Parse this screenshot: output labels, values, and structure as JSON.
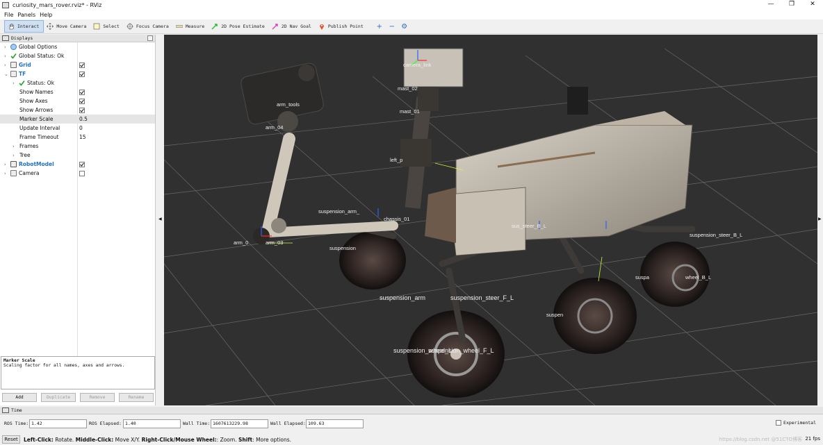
{
  "window": {
    "title": "curiosity_mars_rover.rviz* - RViz",
    "minimize": "—",
    "maximize": "❐",
    "close": "✕"
  },
  "menu": [
    "File",
    "Panels",
    "Help"
  ],
  "toolbar": {
    "tools": [
      {
        "label": "Interact",
        "icon": "cursor-hand-icon",
        "active": true
      },
      {
        "label": "Move Camera",
        "icon": "move-camera-icon",
        "active": false
      },
      {
        "label": "Select",
        "icon": "select-box-icon",
        "active": false
      },
      {
        "label": "Focus Camera",
        "icon": "focus-camera-icon",
        "active": false
      },
      {
        "label": "Measure",
        "icon": "ruler-icon",
        "active": false
      },
      {
        "label": "2D Pose Estimate",
        "icon": "pose-estimate-arrow-icon",
        "active": false
      },
      {
        "label": "2D Nav Goal",
        "icon": "nav-goal-arrow-icon",
        "active": false
      },
      {
        "label": "Publish Point",
        "icon": "map-pin-icon",
        "active": false
      }
    ],
    "extra": [
      "+",
      "−",
      "⚙"
    ]
  },
  "displays": {
    "title": "Displays",
    "rows": [
      {
        "label": "Global Options",
        "indent": 0,
        "arrow": "›",
        "icon": "globe-icon"
      },
      {
        "label": "Global Status: Ok",
        "indent": 0,
        "arrow": "›",
        "icon": "check-icon"
      },
      {
        "label": "Grid",
        "indent": 0,
        "arrow": "›",
        "icon": "grid-icon",
        "blue": true,
        "checked": true
      },
      {
        "label": "TF",
        "indent": 0,
        "arrow": "⌄",
        "icon": "tf-icon",
        "blue": true,
        "checked": true
      },
      {
        "label": "Status: Ok",
        "indent": 1,
        "arrow": "›",
        "icon": "check-icon"
      },
      {
        "label": "Show Names",
        "indent": 1,
        "checked": true
      },
      {
        "label": "Show Axes",
        "indent": 1,
        "checked": true
      },
      {
        "label": "Show Arrows",
        "indent": 1,
        "checked": true
      },
      {
        "label": "Marker Scale",
        "indent": 1,
        "value": "0.5",
        "selected": true
      },
      {
        "label": "Update Interval",
        "indent": 1,
        "value": "0"
      },
      {
        "label": "Frame Timeout",
        "indent": 1,
        "value": "15"
      },
      {
        "label": "Frames",
        "indent": 1,
        "arrow": "›"
      },
      {
        "label": "Tree",
        "indent": 1,
        "arrow": "›"
      },
      {
        "label": "RobotModel",
        "indent": 0,
        "arrow": "›",
        "icon": "robot-model-icon",
        "blue": true,
        "checked": true
      },
      {
        "label": "Camera",
        "indent": 0,
        "arrow": "›",
        "icon": "camera-icon",
        "checked": false
      }
    ],
    "description": {
      "title": "Marker Scale",
      "text": "Scaling factor for all names, axes and arrows."
    },
    "buttons": [
      {
        "label": "Add",
        "enabled": true
      },
      {
        "label": "Duplicate",
        "enabled": false
      },
      {
        "label": "Remove",
        "enabled": false
      },
      {
        "label": "Rename",
        "enabled": false
      }
    ]
  },
  "viewport": {
    "frame_labels": [
      "camera_link",
      "mast_02",
      "mast_01",
      "arm_tools",
      "arm_04",
      "left_p",
      "suspension_arm_",
      "chassis_01",
      "arm_03",
      "arm_0",
      "suspension",
      "sus_steer_B_L",
      "suspension_steer_B_L",
      "suspension_arm",
      "suspension_steer_F_L",
      "suspension_wheel_L",
      "suspension_wheel_F_L",
      "suspa",
      "suspen",
      "wheel_B_L"
    ]
  },
  "time": {
    "title": "Time",
    "ros_time_label": "ROS Time:",
    "ros_time": "1.42",
    "ros_elapsed_label": "ROS Elapsed:",
    "ros_elapsed": "1.40",
    "wall_time_label": "Wall Time:",
    "wall_time": "1607613229.98",
    "wall_elapsed_label": "Wall Elapsed:",
    "wall_elapsed": "109.63",
    "experimental": "Experimental"
  },
  "status": {
    "reset": "Reset",
    "help_parts": [
      {
        "b": "Left-Click:",
        "t": " Rotate. "
      },
      {
        "b": "Middle-Click:",
        "t": " Move X/Y. "
      },
      {
        "b": "Right-Click/Mouse Wheel:",
        "t": ": Zoom. "
      },
      {
        "b": "Shift",
        "t": ": More options."
      }
    ],
    "fps": "21 fps",
    "watermark": "https://blog.csdn.net @51CTO博客"
  },
  "colors": {
    "viewport_bg": "#303030",
    "selection_blue": "#1f6fc2",
    "active_tool": "#cfe0f2"
  }
}
